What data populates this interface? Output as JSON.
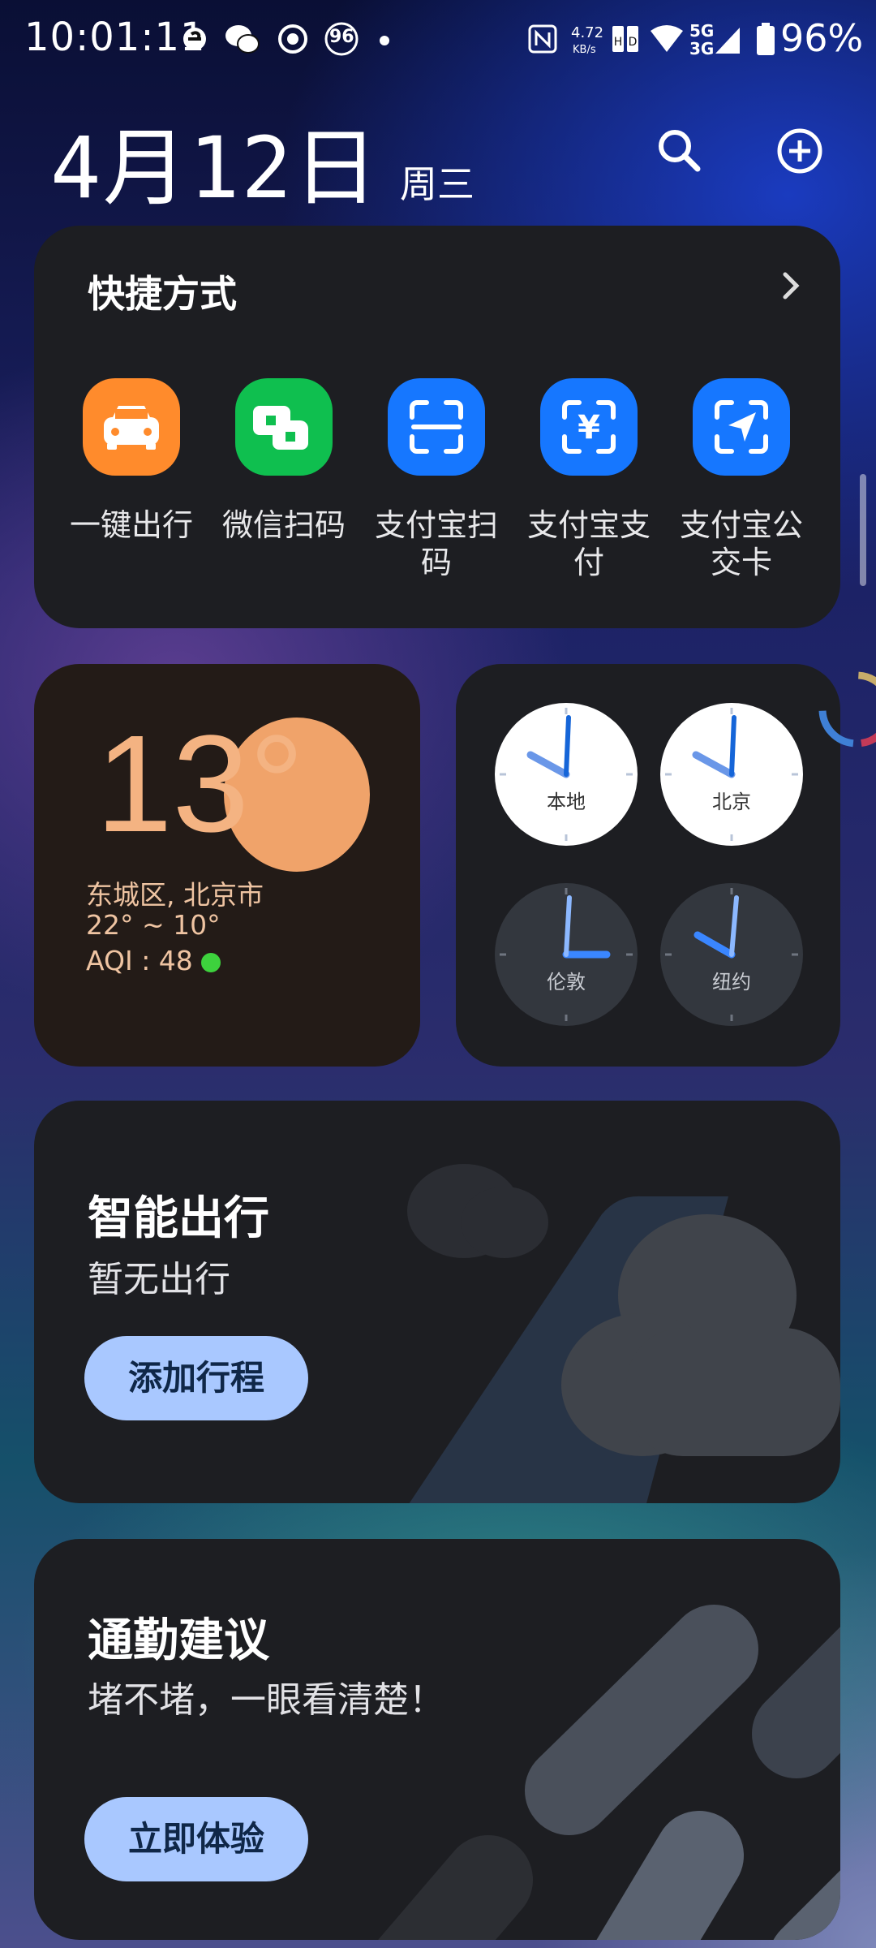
{
  "status_bar": {
    "time": "10:01:11",
    "network_speed": "4.72",
    "network_speed_unit": "KB/s",
    "notif_badge": "96",
    "signal_top": "5G",
    "signal_bottom": "3G",
    "battery": "96%"
  },
  "header": {
    "date": "4月12日",
    "weekday": "周三"
  },
  "shortcuts": {
    "title": "快捷方式",
    "items": [
      {
        "label": "一键出行",
        "icon": "car-icon",
        "color": "#ff8b2c"
      },
      {
        "label": "微信扫码",
        "icon": "wechat-scan-icon",
        "color": "#0fbf4f"
      },
      {
        "label": "支付宝扫码",
        "icon": "alipay-scan-icon",
        "color": "#1677ff"
      },
      {
        "label": "支付宝支付",
        "icon": "alipay-pay-icon",
        "color": "#1677ff"
      },
      {
        "label": "支付宝公交卡",
        "icon": "alipay-bus-icon",
        "color": "#1677ff"
      }
    ]
  },
  "weather": {
    "temperature": "13°",
    "location": "东城区, 北京市",
    "range": "22° ~ 10°",
    "aqi": "AQI : 48"
  },
  "world_clock": {
    "clocks": [
      {
        "label": "本地",
        "theme": "light"
      },
      {
        "label": "北京",
        "theme": "light"
      },
      {
        "label": "伦敦",
        "theme": "dark"
      },
      {
        "label": "纽约",
        "theme": "dark"
      }
    ]
  },
  "smart_travel": {
    "title": "智能出行",
    "subtitle": "暂无出行",
    "button": "添加行程"
  },
  "commute": {
    "title": "通勤建议",
    "subtitle": "堵不堵，一眼看清楚！",
    "button": "立即体验"
  }
}
